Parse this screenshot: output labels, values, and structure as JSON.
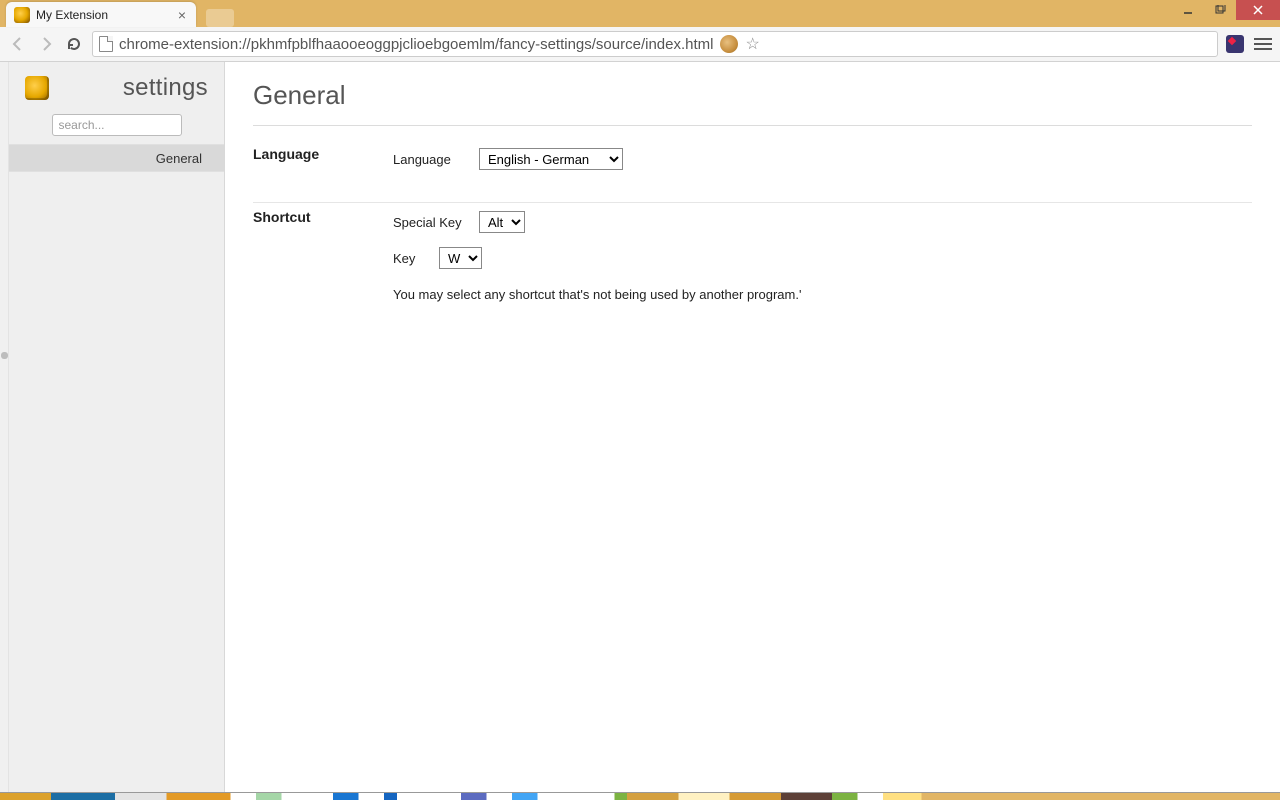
{
  "window": {
    "tab_title": "My Extension"
  },
  "address_bar": {
    "url": "chrome-extension://pkhmfpblfhaaooeoggpjclioebgoemlm/fancy-settings/source/index.html"
  },
  "sidebar": {
    "title": "settings",
    "search_placeholder": "search...",
    "items": [
      {
        "label": "General",
        "active": true
      }
    ]
  },
  "page": {
    "title": "General",
    "sections": [
      {
        "heading": "Language",
        "fields": [
          {
            "label": "Language",
            "value": "English - German"
          }
        ]
      },
      {
        "heading": "Shortcut",
        "fields": [
          {
            "label": "Special Key",
            "value": "Alt"
          },
          {
            "label": "Key",
            "value": "W"
          }
        ],
        "note": "You may select any shortcut that's not being used by another program.'"
      }
    ]
  }
}
